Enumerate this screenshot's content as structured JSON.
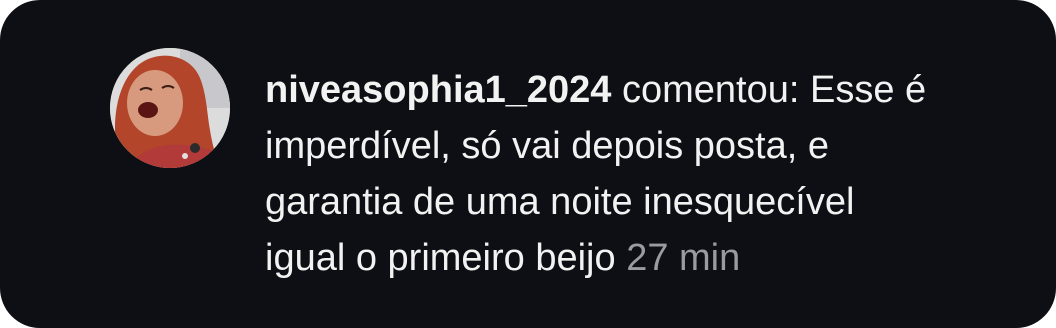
{
  "comment": {
    "username": "niveasophia1_2024",
    "action": "comentou:",
    "lines": [
      "Esse é",
      "imperdível, só vai depois posta, e",
      "garantia de uma noite inesquecível",
      "igual o primeiro beijo"
    ],
    "time": "27 min"
  },
  "avatar": {
    "icon": "profile-photo"
  },
  "colors": {
    "card_background": "#0e0f14",
    "text": "#f2f2f2",
    "timestamp": "#9a9aa0"
  }
}
